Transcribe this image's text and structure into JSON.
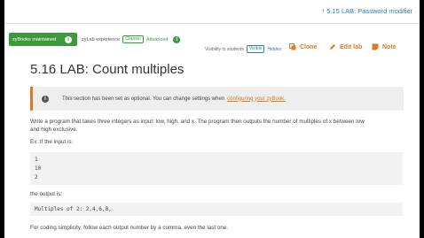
{
  "header": {
    "next_section": "5.15 LAB: Password modifier"
  },
  "toolbar": {
    "maintained_badge": "zyBooks maintained",
    "experience_label": "zyLab experience",
    "classic_label": "Classic",
    "advanced_label": "Advanced",
    "visibility_label": "Visibility to students",
    "visible_label": "Visible",
    "hidden_label": "Hidden",
    "clone_label": "Clone",
    "edit_label": "Edit lab",
    "note_label": "Note"
  },
  "title": "5.16 LAB: Count multiples",
  "notice": {
    "text": "This section has been set as optional. You can change settings when",
    "link": "configuring your zyBook."
  },
  "body": {
    "intro_line1": "Write a program that takes three integers as input: low, high, and x. The program then outputs the number of multiples of x between low",
    "intro_line2": "and high exclusive.",
    "example_label": "Ex: If the input is:",
    "input_lines": [
      "1",
      "10",
      "2"
    ],
    "output_label": "the output is:",
    "output_line": "Multiples of 2: 2,4,6,8,",
    "simplicity_note": "For coding simplicity, follow each output number by a comma, even the last one."
  },
  "colors": {
    "accent": "#d77d1f",
    "green": "#3b9b3b",
    "link": "#2d7fb8"
  }
}
